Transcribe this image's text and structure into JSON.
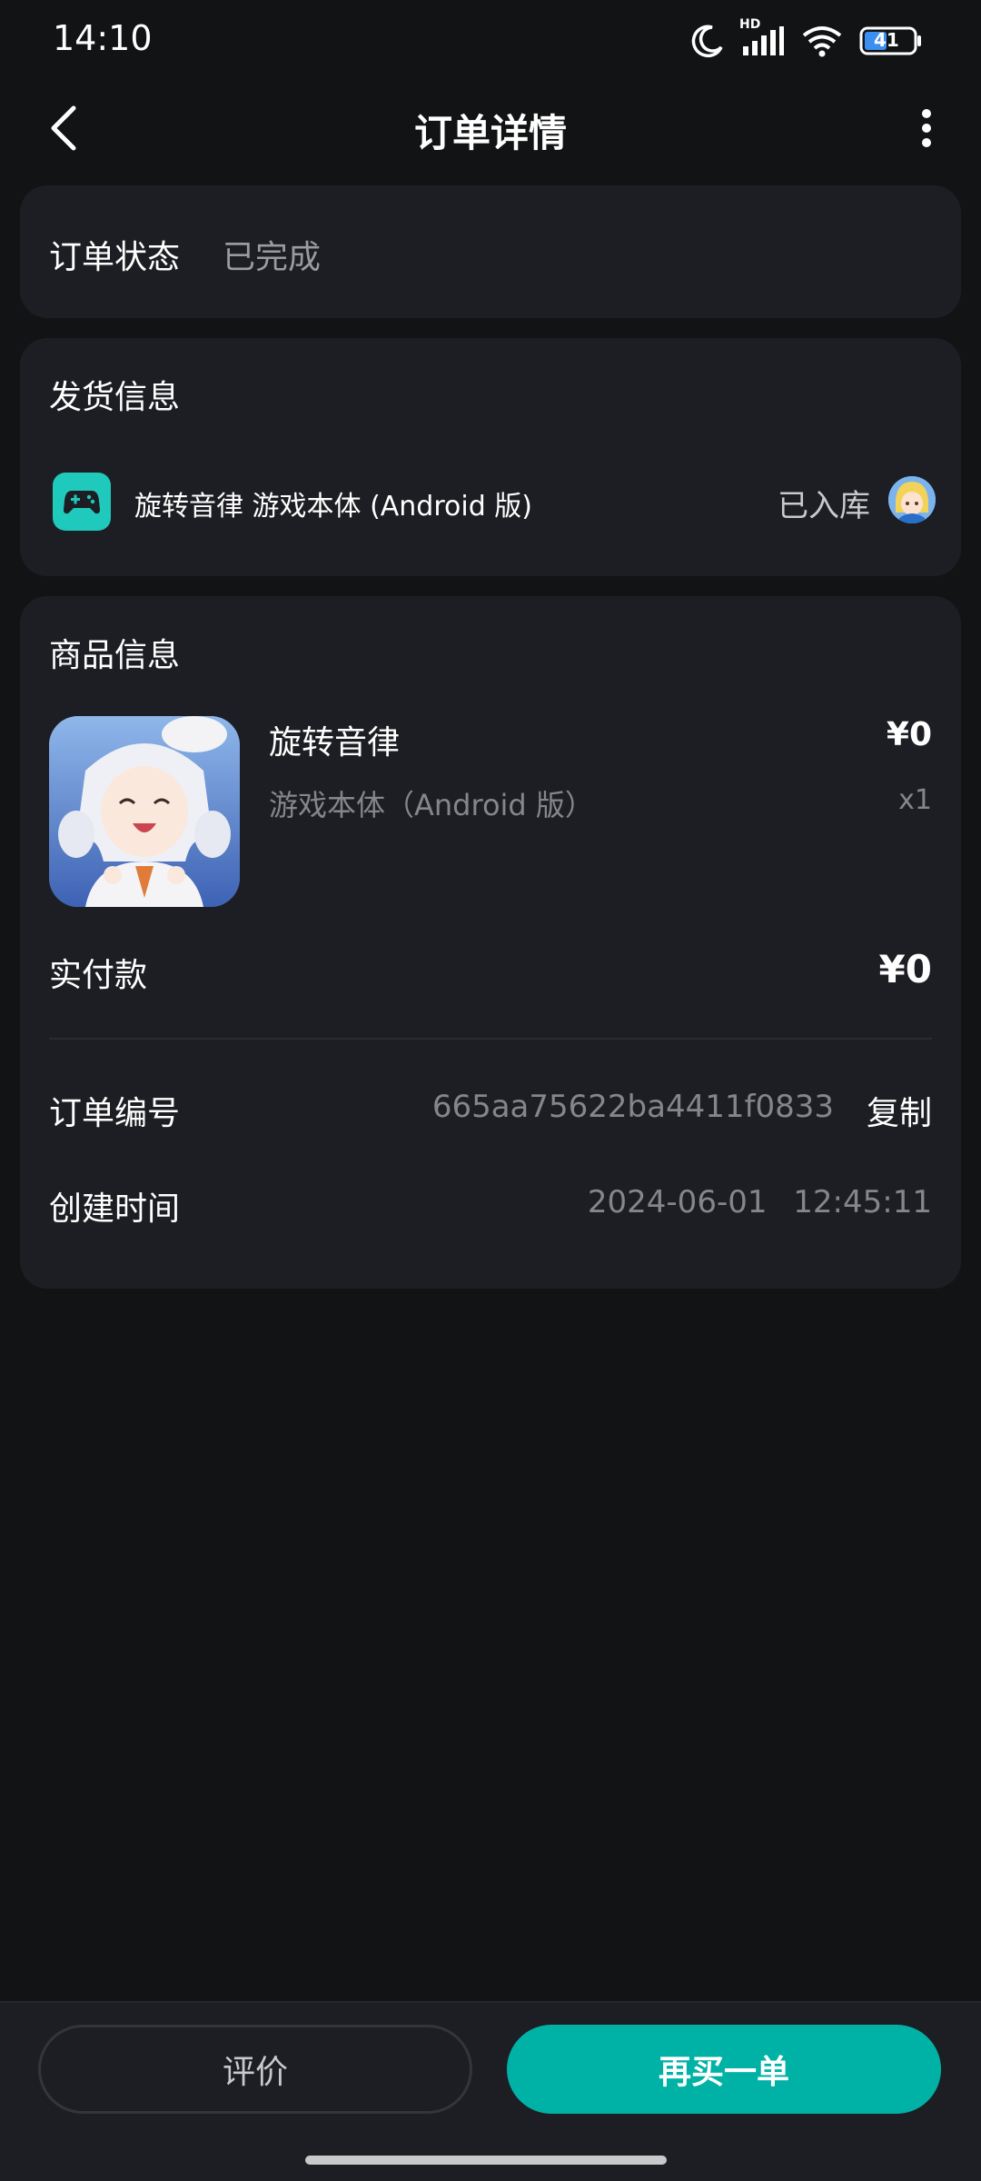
{
  "status_bar": {
    "time": "14:10",
    "battery": "41",
    "network_badge": "HD",
    "icons": [
      "moon-icon",
      "signal-icon",
      "wifi-icon",
      "battery-icon"
    ]
  },
  "nav": {
    "title": "订单详情",
    "back_icon": "chevron-left-icon",
    "more_icon": "more-vertical-icon"
  },
  "order_status": {
    "label": "订单状态",
    "value": "已完成"
  },
  "delivery": {
    "title": "发货信息",
    "item_name": "旋转音律 游戏本体 (Android 版)",
    "item_icon": "gamepad-icon",
    "status": "已入库"
  },
  "product": {
    "title": "商品信息",
    "name": "旋转音律",
    "variant": "游戏本体（Android 版）",
    "price": "¥0",
    "quantity": "x1",
    "paid_label": "实付款",
    "paid_value": "¥0",
    "order_no_label": "订单编号",
    "order_no_value": "665aa75622ba4411f0833",
    "copy_label": "复制",
    "created_label": "创建时间",
    "created_value": "2024-06-01 12:45:11"
  },
  "actions": {
    "review_label": "评价",
    "rebuy_label": "再买一单"
  },
  "colors": {
    "background": "#121314",
    "card": "#1d1e23",
    "accent": "#00b2a6",
    "text_secondary": "#85868b"
  }
}
